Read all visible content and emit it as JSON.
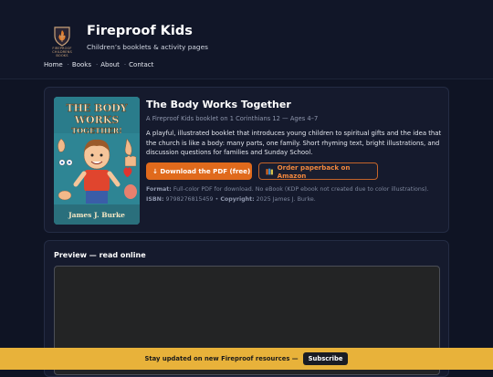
{
  "site": {
    "title": "Fireproof Kids",
    "tagline": "Children’s booklets & activity pages",
    "logo_text": "FIREPROOF CHILDRENS BOOKS"
  },
  "nav": {
    "items": [
      "Home",
      "Books",
      "About",
      "Contact"
    ],
    "separator": "·"
  },
  "book": {
    "title": "The Body Works Together",
    "subtitle": "A Fireproof Kids booklet on 1 Corinthians 12 — Ages 4–7",
    "description": "A playful, illustrated booklet that introduces young children to spiritual gifts and the idea that the church is like a body: many parts, one family. Short rhyming text, bright illustrations, and discussion questions for families and Sunday School.",
    "cover": {
      "title_line1": "THE BODY",
      "title_line2": "WORKS",
      "title_line3": "TOGETHER!",
      "author": "James J. Burke"
    },
    "download_label": "↓ Download the PDF (free)",
    "amazon_label": "Order paperback on Amazon",
    "format_label": "Format:",
    "format_value": "Full-color PDF for download. No eBook (KDP ebook not created due to color illustrations).",
    "isbn_label": "ISBN:",
    "isbn_value": "9798276815459",
    "copyright_label": "Copyright:",
    "copyright_value": "2025 James J. Burke."
  },
  "preview": {
    "title": "Preview — read online"
  },
  "banner": {
    "text": "Stay updated on new Fireproof resources —",
    "button": "Subscribe"
  },
  "colors": {
    "accent": "#e06a1c",
    "banner": "#e8b23a",
    "background": "#0f1424"
  }
}
